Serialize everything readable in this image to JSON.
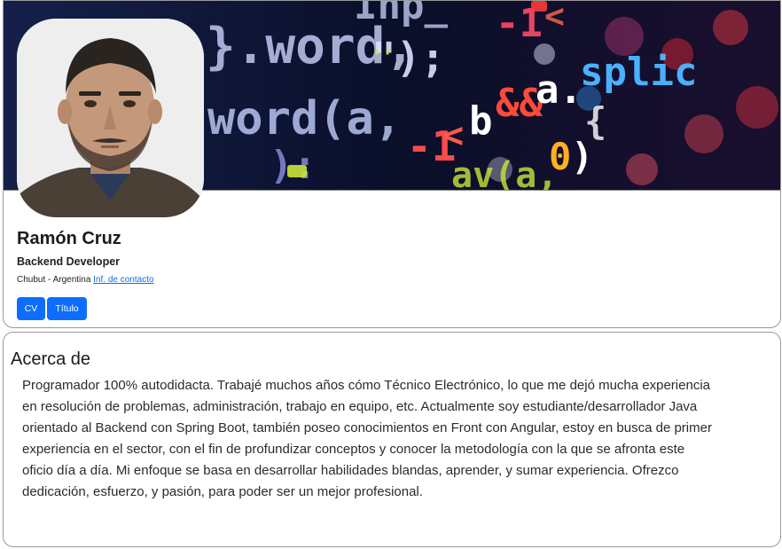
{
  "profile": {
    "name": "Ramón Cruz",
    "role": "Backend Developer",
    "location": "Chubut - Argentina",
    "contact_link": "Inf. de contacto",
    "buttons": {
      "cv": "CV",
      "title": "Título"
    }
  },
  "banner": {
    "image": "code-background",
    "code_fragments": [
      "}.word,",
      "Inp_",
      "-1",
      "&&",
      "a.splic",
      "word(a,",
      "\");",
      "-1 < b && a.",
      "):",
      "(a,",
      "0)"
    ]
  },
  "avatar": {
    "image": "profile-photo"
  },
  "about": {
    "heading": "Acerca de",
    "text": "Programador 100% autodidacta. Trabajé muchos años cómo Técnico Electrónico, lo que me dejó mucha experiencia en resolución de problemas, administración, trabajo en equipo, etc. Actualmente soy estudiante/desarrollador Java orientado al Backend con Spring Boot, también poseo conocimientos en Front con Angular, estoy en busca de primer experiencia en el sector, con el fin de profundizar conceptos y conocer la metodología con la que se afronta este oficio día a día. Mi enfoque se basa en desarrollar habilidades blandas, aprender, y sumar experiencia. Ofrezco dedicación, esfuerzo, y pasión, para poder ser un mejor profesional."
  },
  "colors": {
    "primary": "#0d6efd",
    "link": "#0d6efd",
    "border": "#9a9a9a"
  }
}
